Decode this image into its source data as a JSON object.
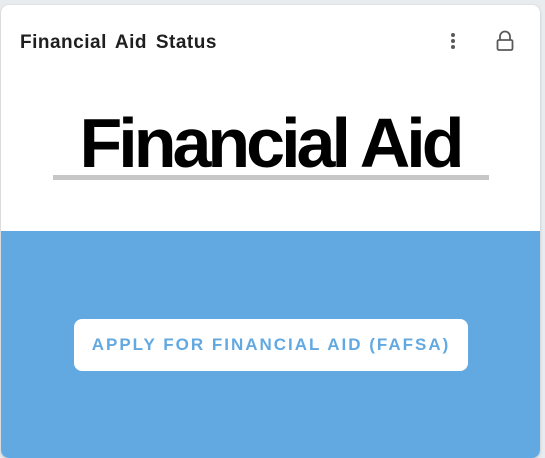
{
  "card": {
    "title": "Financial Aid Status",
    "menu_icon": "more-vertical-icon",
    "lock_icon": "lock-icon"
  },
  "banner": {
    "text": "Financial Aid"
  },
  "action": {
    "button_label": "APPLY FOR FINANCIAL AID (FAFSA)"
  },
  "colors": {
    "accent": "#62a9e2",
    "title_text": "#1f1f1f",
    "card_bg": "#ffffff",
    "underline": "#c7c7c7"
  }
}
